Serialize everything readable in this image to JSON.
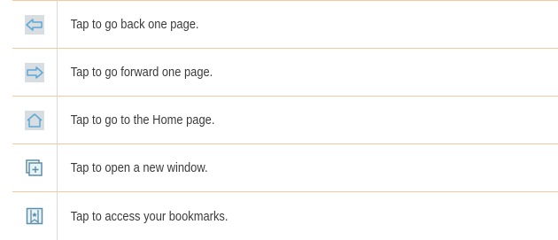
{
  "rows": [
    {
      "icon": "back-arrow-icon",
      "text": "Tap to go back one page."
    },
    {
      "icon": "forward-arrow-icon",
      "text": "Tap to go forward one page."
    },
    {
      "icon": "home-icon",
      "text": "Tap to go to the Home page."
    },
    {
      "icon": "new-window-icon",
      "text": "Tap to open a new window."
    },
    {
      "icon": "bookmark-icon",
      "text": "Tap to access your bookmarks."
    }
  ],
  "colors": {
    "row_divider": "#f4c9a0",
    "icon_accent": "#5aa9d6",
    "icon_tint_bg": "#d8dde2",
    "text": "#3a3a3a"
  }
}
